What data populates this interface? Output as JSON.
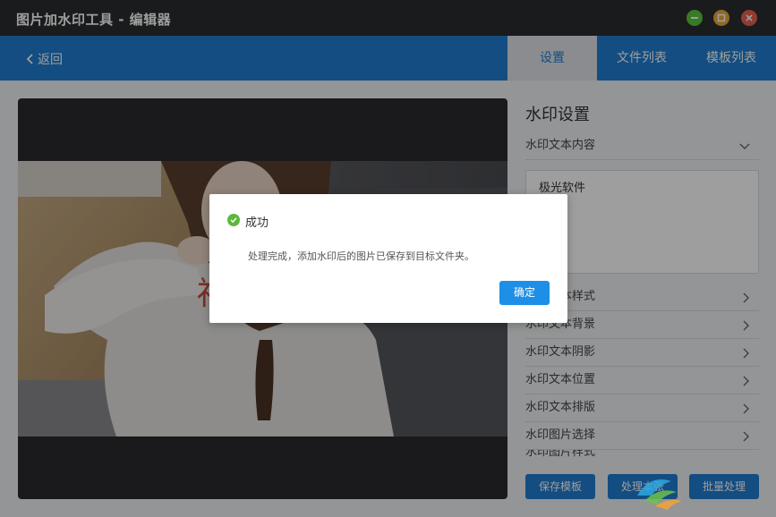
{
  "window": {
    "title": "图片加水印工具 - 编辑器"
  },
  "nav": {
    "back_label": "返回",
    "tabs": [
      {
        "label": "设置"
      },
      {
        "label": "文件列表"
      },
      {
        "label": "模板列表"
      }
    ]
  },
  "panel": {
    "title": "水印设置",
    "text_content_label": "水印文本内容",
    "text_value": "极光软件",
    "rows": [
      {
        "label": "水印文本样式"
      },
      {
        "label": "水印文本背景"
      },
      {
        "label": "水印文本阴影"
      },
      {
        "label": "水印文本位置"
      },
      {
        "label": "水印文本排版"
      },
      {
        "label": "水印图片选择"
      },
      {
        "label": "水印图片样式"
      }
    ],
    "buttons": {
      "save_template": "保存模板",
      "process_current": "处理本张",
      "batch_process": "批量处理"
    }
  },
  "dialog": {
    "title": "成功",
    "message": "处理完成，添加水印后的图片已保存到目标文件夹。",
    "ok_label": "确定"
  },
  "colors": {
    "titlebar": "#2b2c2e",
    "accent": "#1f7dd0",
    "success": "#5bb83a"
  }
}
